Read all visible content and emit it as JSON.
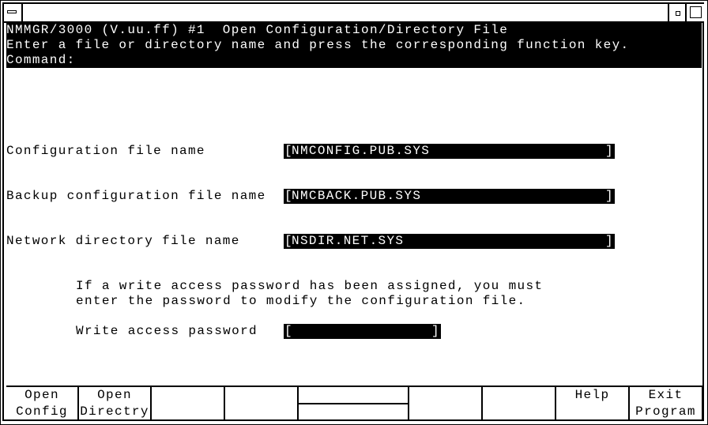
{
  "window": {
    "system_menu_icon": "system-menu-icon",
    "minimize_icon": "minimize-icon",
    "maximize_icon": "maximize-icon"
  },
  "header": {
    "title": "NMMGR/3000 (V.uu.ff) #1  Open Configuration/Directory File",
    "instruction": "Enter a file or directory name and press the corresponding function key.",
    "command_label": "Command:",
    "command_value": ""
  },
  "form": {
    "fields": [
      {
        "label": "Configuration file name",
        "value": "NMCONFIG.PUB.SYS"
      },
      {
        "label": "Backup configuration file name",
        "value": "NMCBACK.PUB.SYS"
      },
      {
        "label": "Network directory file name",
        "value": "NSDIR.NET.SYS"
      }
    ],
    "note_line1": "If a write access password has been assigned, you must",
    "note_line2": "enter the password to modify the configuration file.",
    "password_label": "Write access password",
    "password_value": "",
    "bracket_open": "[",
    "bracket_close": "]"
  },
  "function_keys": [
    {
      "line1": "Open",
      "line2": "Config"
    },
    {
      "line1": "Open",
      "line2": "Directry"
    },
    {
      "line1": "",
      "line2": ""
    },
    {
      "line1": "",
      "line2": ""
    },
    {
      "line1": "",
      "line2": ""
    },
    {
      "line1": "",
      "line2": ""
    },
    {
      "line1": "",
      "line2": ""
    },
    {
      "line1": "Help",
      "line2": ""
    },
    {
      "line1": "Exit",
      "line2": "Program"
    }
  ]
}
